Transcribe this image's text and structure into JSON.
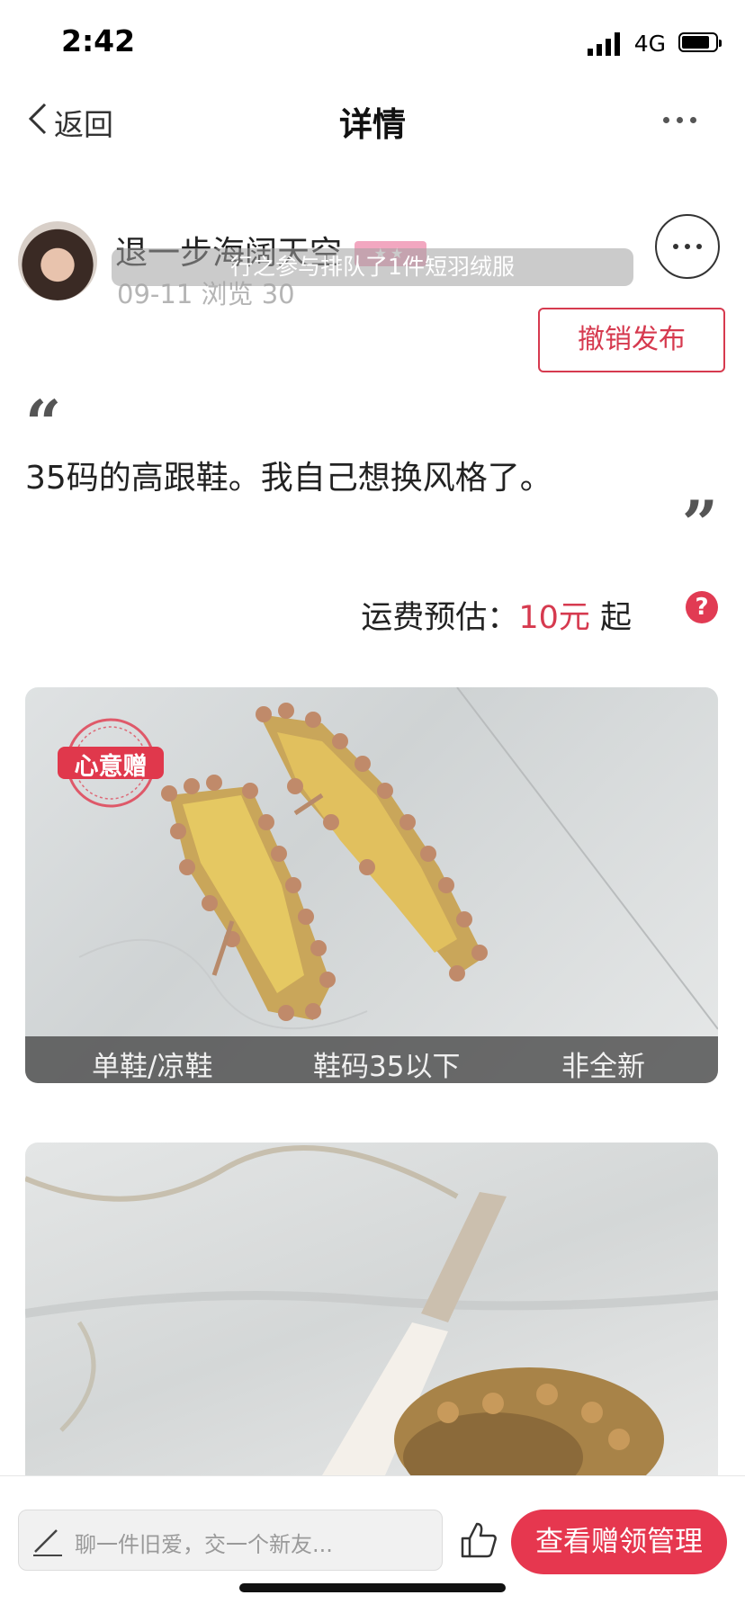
{
  "status_bar": {
    "time": "2:42",
    "network": "4G"
  },
  "nav": {
    "back_label": "返回",
    "title": "详情"
  },
  "post": {
    "username": "退一步海阔天空",
    "level_badge": "★★",
    "meta": "09-11 浏览 30",
    "toast": "行之参与排队了1件短羽绒服",
    "revoke_label": "撤销发布",
    "quote_open": "“",
    "quote_close": "”",
    "description": "35码的高跟鞋。我自己想换风格了。"
  },
  "shipping": {
    "label": "运费预估：",
    "price": "10元",
    "suffix": " 起",
    "help": "?"
  },
  "photo1": {
    "stamp_text": "心意赠",
    "tags": [
      "单鞋/凉鞋",
      "鞋码35以下",
      "非全新"
    ]
  },
  "bottom": {
    "comment_placeholder": "聊一件旧爱，交一个新友...",
    "cta_label": "查看赠领管理"
  },
  "colors": {
    "accent": "#e6374f",
    "accent_text": "#d63a4f"
  },
  "icons": [
    "back-chevron-icon",
    "more-icon",
    "help-icon",
    "pen-icon",
    "thumbs-up-icon",
    "signal-icon",
    "battery-icon"
  ]
}
